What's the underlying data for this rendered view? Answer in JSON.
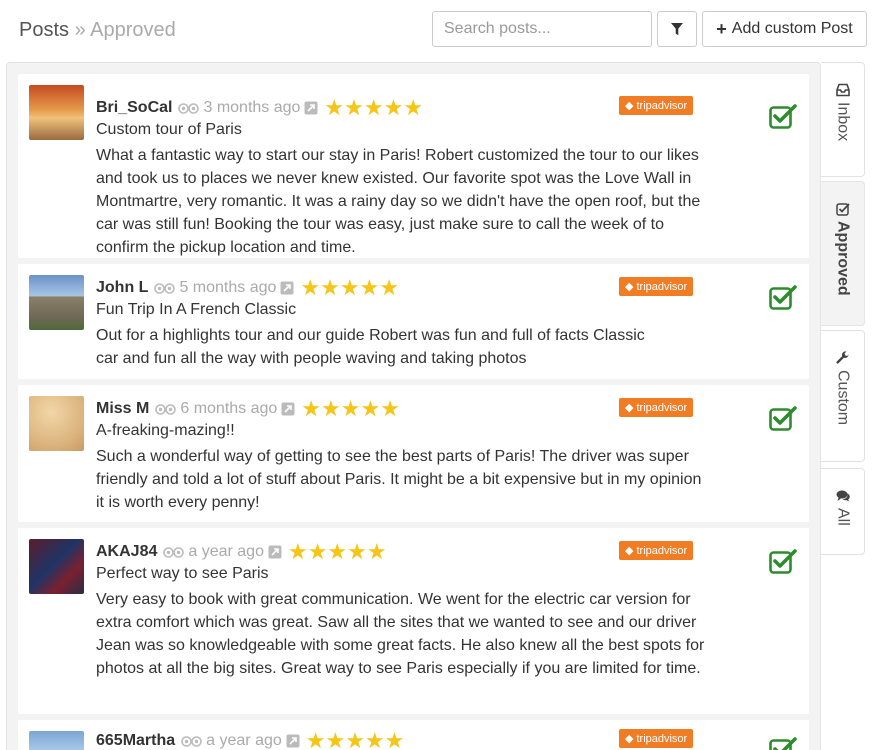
{
  "breadcrumb": {
    "root": "Posts",
    "separator": "»",
    "current": "Approved"
  },
  "search": {
    "placeholder": "Search posts..."
  },
  "toolbar": {
    "filter_icon": "filter-icon",
    "add_label": "Add custom Post",
    "add_icon": "plus-icon"
  },
  "tabs": [
    {
      "label": "Inbox",
      "icon": "inbox-icon",
      "active": false
    },
    {
      "label": "Approved",
      "icon": "checkbox-icon",
      "active": true
    },
    {
      "label": "Custom",
      "icon": "wrench-icon",
      "active": false
    },
    {
      "label": "All",
      "icon": "comments-icon",
      "active": false
    }
  ],
  "colors": {
    "star": "#f5c518",
    "badge": "#f07d23",
    "check": "#2e8b2e"
  },
  "posts": [
    {
      "author": "Bri_SoCal",
      "time": "3 months ago",
      "rating": 5,
      "stars": "★★★★★",
      "source": "tripadvisor",
      "approved": true,
      "title": "Custom tour of Paris",
      "body": "What a fantastic way to start our stay in Paris! Robert customized the tour to our likes and took us to places we never knew existed. Our favorite spot was the Love Wall in Montmartre, very romantic. It was a rainy day so we didn't have the open roof, but the car was still fun! Booking the tour was easy, just make sure to call the week of to confirm the pickup location and time."
    },
    {
      "author": "John L",
      "time": "5 months ago",
      "rating": 5,
      "stars": "★★★★★",
      "source": "tripadvisor",
      "approved": true,
      "title": "Fun Trip In A French Classic",
      "body": "Out for a highlights tour and our guide Robert was fun and full of facts Classic car and fun all the way with people waving and taking photos"
    },
    {
      "author": "Miss M",
      "time": "6 months ago",
      "rating": 5,
      "stars": "★★★★★",
      "source": "tripadvisor",
      "approved": true,
      "title": "A-freaking-mazing!!",
      "body": "Such a wonderful way of getting to see the best parts of Paris! The driver was super friendly and told a lot of stuff about Paris. It might be a bit expensive but in my opinion it is worth every penny!"
    },
    {
      "author": "AKAJ84",
      "time": "a year ago",
      "rating": 5,
      "stars": "★★★★★",
      "source": "tripadvisor",
      "approved": true,
      "title": "Perfect way to see Paris",
      "body": "Very easy to book with great communication. We went for the electric car version for extra comfort which was great. Saw all the sites that we wanted to see and our driver Jean was so knowledgeable with some great facts. He also knew all the best spots for photos at all the big sites. Great way to see Paris especially if you are limited for time."
    },
    {
      "author": "665Martha",
      "time": "a year ago",
      "rating": 5,
      "stars": "★★★★★",
      "source": "tripadvisor",
      "approved": true,
      "title": "",
      "body": ""
    }
  ]
}
